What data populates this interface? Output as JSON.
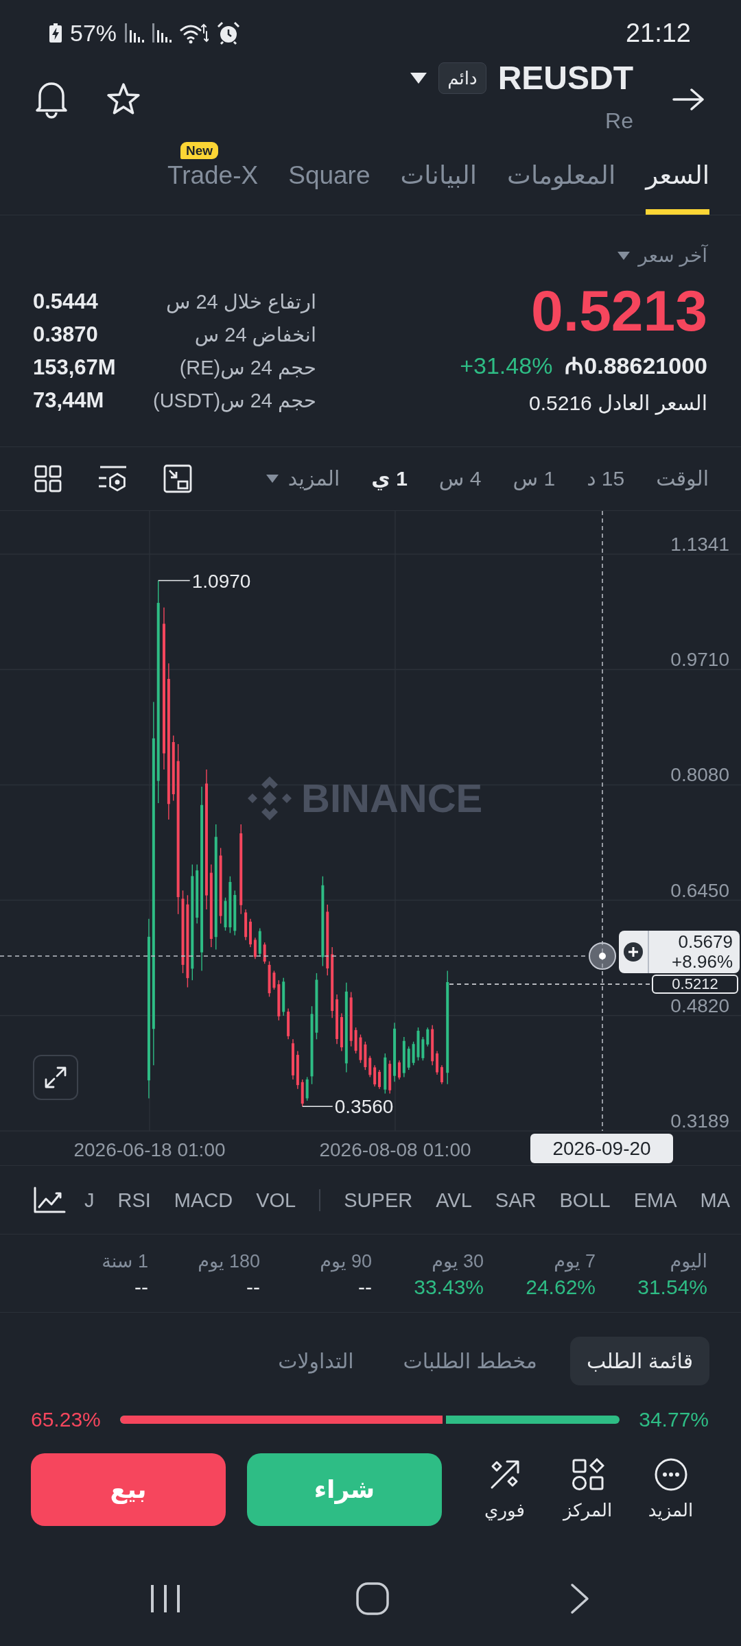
{
  "status_bar": {
    "battery": "57%",
    "time": "21:12"
  },
  "header": {
    "symbol": "REUSDT",
    "badge": "دائم",
    "subtitle": "Re"
  },
  "tabs": [
    {
      "label": "السعر",
      "selected": true
    },
    {
      "label": "المعلومات",
      "selected": false
    },
    {
      "label": "البيانات",
      "selected": false
    },
    {
      "label": "Square",
      "selected": false
    },
    {
      "label": "Trade-X",
      "selected": false,
      "badge": "New"
    }
  ],
  "price": {
    "label": "آخر سعر",
    "last": "0.5213",
    "falling": true,
    "fiat": "₼0.88621000",
    "change": "+31.48%",
    "change_rising": true,
    "fair_price": "السعر العادل 0.5216"
  },
  "stats": [
    {
      "label": "ارتفاع خلال 24 س",
      "value": "0.5444"
    },
    {
      "label": "انخفاض 24 س",
      "value": "0.3870"
    },
    {
      "label": "حجم 24 س(RE)",
      "value": "153,67M"
    },
    {
      "label": "حجم 24 س(USDT)",
      "value": "73,44M"
    }
  ],
  "intervals": {
    "items": [
      {
        "label": "الوقت",
        "selected": false
      },
      {
        "label": "15 د",
        "selected": false
      },
      {
        "label": "1 س",
        "selected": false
      },
      {
        "label": "4 س",
        "selected": false
      },
      {
        "label": "1 ي",
        "selected": true
      }
    ],
    "more": "المزيد"
  },
  "chart": {
    "watermark": "BINANCE",
    "price_axis": [
      "1.1341",
      "0.9710",
      "0.8080",
      "0.6450",
      "0.4820",
      "0.3189"
    ],
    "time_axis": [
      "2026-08-08 01:00",
      "2026-06-18 01:00"
    ],
    "high": "1.0970",
    "low": "0.3560",
    "last_price_tag": "0.5212",
    "crosshair": {
      "price": "0.5679",
      "change": "+8.96%",
      "date": "2026-09-20"
    }
  },
  "indicators": {
    "main": [
      "MA",
      "EMA",
      "BOLL",
      "SAR",
      "AVL",
      "SUPER"
    ],
    "sub": [
      "VOL",
      "MACD",
      "RSI",
      "J"
    ]
  },
  "performance": [
    {
      "period": "اليوم",
      "value": "31.54%",
      "rising": true
    },
    {
      "period": "7 يوم",
      "value": "24.62%",
      "rising": true
    },
    {
      "period": "30 يوم",
      "value": "33.43%",
      "rising": true
    },
    {
      "period": "90 يوم",
      "value": "--",
      "rising": false
    },
    {
      "period": "180 يوم",
      "value": "--",
      "rising": false
    },
    {
      "period": "1 سنة",
      "value": "--",
      "rising": false
    }
  ],
  "book_tabs": [
    {
      "label": "قائمة الطلب",
      "selected": true
    },
    {
      "label": "مخطط الطلبات",
      "selected": false
    },
    {
      "label": "التداولات",
      "selected": false
    }
  ],
  "ratio": {
    "sell": "65.23%",
    "buy": "34.77%",
    "level": 0.6523
  },
  "actions": {
    "sell": "بيع",
    "buy": "شراء",
    "more": "المزيد",
    "position": "المركز",
    "instant": "فوري"
  }
}
